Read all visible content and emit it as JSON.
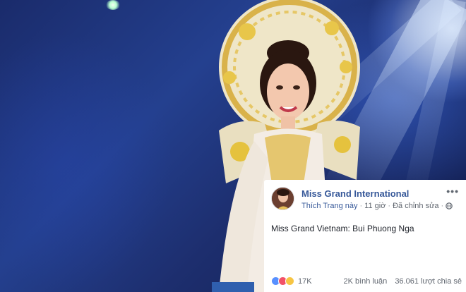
{
  "post": {
    "page_name": "Miss Grand International",
    "like_page_label": "Thích Trang này",
    "separator": "·",
    "time_ago": "11 giờ",
    "edited_label": "Đã chỉnh sửa",
    "privacy_icon": "globe-icon",
    "more_icon": "more-options-icon",
    "more_glyph": "•••",
    "text": "Miss Grand Vietnam: Bui Phuong Nga",
    "reaction_icons": [
      "like-reaction-icon",
      "love-reaction-icon",
      "wow-reaction-icon"
    ],
    "reaction_count": "17K",
    "comments": "2K bình luận",
    "shares": "36.061 lượt chia sẻ"
  },
  "colors": {
    "page_name": "#365899",
    "meta_text": "#616770",
    "body_text": "#1d2129",
    "like_reaction": "#5890ff",
    "love_reaction": "#f25268",
    "wow_reaction": "#f7c543"
  }
}
